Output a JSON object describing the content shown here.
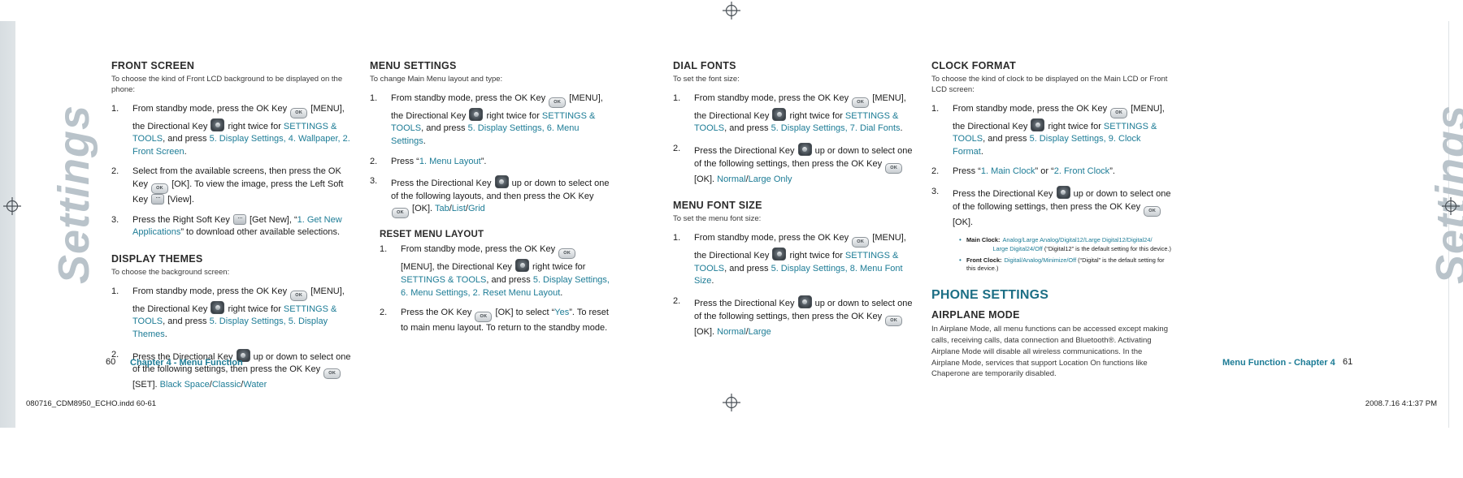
{
  "meta": {
    "watermark": "Settings",
    "file_stamp": "080716_CDM8950_ECHO.indd   60-61",
    "time_stamp": "2008.7.16   4:1:37 PM",
    "left_page_number": "60",
    "right_page_number": "61",
    "left_chapter": "Chapter 4 - Menu Function",
    "right_chapter": "Menu Function - Chapter 4",
    "accent_color": "#1d7c96",
    "heading_color": "#2b2b2b"
  },
  "keys": {
    "ok": "OK",
    "ok_name": "ok-key-icon",
    "dir_name": "directional-key-icon",
    "soft_name": "soft-key-icon"
  },
  "columns": [
    {
      "id": "front-screen",
      "sections": [
        {
          "type": "section",
          "title": "FRONT SCREEN",
          "intro": "To choose the kind of Front LCD background to be displayed on the phone:",
          "steps": [
            {
              "num": "1.",
              "parts": [
                {
                  "t": "From standby mode, press the OK Key ",
                  "k": ""
                },
                {
                  "key": "ok"
                },
                {
                  "t": " [MENU], the Directional Key "
                },
                {
                  "key": "dir"
                },
                {
                  "t": " right twice for "
                },
                {
                  "blue": "SETTINGS & TOOLS"
                },
                {
                  "t": ", and press "
                },
                {
                  "blue": "5. Display Settings, 4. Wallpaper, 2. Front Screen"
                },
                {
                  "t": "."
                }
              ]
            },
            {
              "num": "2.",
              "parts": [
                {
                  "t": "Select from the available screens, then press the OK Key "
                },
                {
                  "key": "ok"
                },
                {
                  "t": " [OK]. To view the image, press the Left Soft Key "
                },
                {
                  "key": "soft"
                },
                {
                  "t": " [View]."
                }
              ]
            },
            {
              "num": "3.",
              "parts": [
                {
                  "t": "Press the Right Soft Key "
                },
                {
                  "key": "soft"
                },
                {
                  "t": " [Get New], “"
                },
                {
                  "blue": "1. Get New Applications"
                },
                {
                  "t": "” to download other available selections."
                }
              ]
            }
          ]
        },
        {
          "type": "section",
          "title": "DISPLAY THEMES",
          "intro": "To choose the background screen:",
          "steps": [
            {
              "num": "1.",
              "parts": [
                {
                  "t": "From standby mode, press the OK Key "
                },
                {
                  "key": "ok"
                },
                {
                  "t": " [MENU], the Directional Key "
                },
                {
                  "key": "dir"
                },
                {
                  "t": " right twice for "
                },
                {
                  "blue": "SETTINGS & TOOLS"
                },
                {
                  "t": ", and press "
                },
                {
                  "blue": "5. Display Settings, 5. Display Themes"
                },
                {
                  "t": "."
                }
              ]
            },
            {
              "num": "2.",
              "parts": [
                {
                  "t": "Press the Directional Key "
                },
                {
                  "key": "dir"
                },
                {
                  "t": " up or down to select one of the following settings, then press the OK Key "
                },
                {
                  "key": "ok"
                },
                {
                  "t": " [SET]. "
                },
                {
                  "blue": "Black Space"
                },
                {
                  "t": "/"
                },
                {
                  "blue": "Classic"
                },
                {
                  "t": "/"
                },
                {
                  "blue": "Water"
                }
              ]
            }
          ]
        }
      ]
    },
    {
      "id": "menu-settings",
      "sections": [
        {
          "type": "section",
          "title": "MENU SETTINGS",
          "intro": "To change Main Menu layout and type:",
          "steps": [
            {
              "num": "1.",
              "parts": [
                {
                  "t": "From standby mode, press the OK Key "
                },
                {
                  "key": "ok"
                },
                {
                  "t": " [MENU], the Directional Key "
                },
                {
                  "key": "dir"
                },
                {
                  "t": " right twice for "
                },
                {
                  "blue": "SETTINGS & TOOLS"
                },
                {
                  "t": ", and press "
                },
                {
                  "blue": "5. Display Settings, 6. Menu Settings"
                },
                {
                  "t": "."
                }
              ]
            },
            {
              "num": "2.",
              "parts": [
                {
                  "t": "Press “"
                },
                {
                  "blue": "1. Menu Layout"
                },
                {
                  "t": "”."
                }
              ]
            },
            {
              "num": "3.",
              "parts": [
                {
                  "t": "Press the Directional Key "
                },
                {
                  "key": "dir"
                },
                {
                  "t": " up or down to select one of the following layouts, and then press the OK Key "
                },
                {
                  "key": "ok"
                },
                {
                  "t": " [OK]. "
                },
                {
                  "blue": "Tab"
                },
                {
                  "t": "/"
                },
                {
                  "blue": "List"
                },
                {
                  "t": "/"
                },
                {
                  "blue": "Grid"
                }
              ]
            }
          ]
        },
        {
          "type": "subsection",
          "title": "RESET MENU LAYOUT",
          "intro": "",
          "steps": [
            {
              "num": "1.",
              "parts": [
                {
                  "t": "From standby mode, press the OK Key "
                },
                {
                  "key": "ok"
                },
                {
                  "t": " [MENU], the Directional Key "
                },
                {
                  "key": "dir"
                },
                {
                  "t": " right twice for "
                },
                {
                  "blue": "SETTINGS & TOOLS"
                },
                {
                  "t": ", and press "
                },
                {
                  "blue": "5. Display Settings, 6. Menu Settings, 2. Reset Menu Layout"
                },
                {
                  "t": "."
                }
              ]
            },
            {
              "num": "2.",
              "parts": [
                {
                  "t": "Press the OK Key "
                },
                {
                  "key": "ok"
                },
                {
                  "t": " [OK] to select “"
                },
                {
                  "blue": "Yes"
                },
                {
                  "t": "”. To reset to main menu layout. To return to the standby mode."
                }
              ]
            }
          ]
        }
      ]
    },
    {
      "id": "dial-fonts",
      "sections": [
        {
          "type": "section",
          "title": "DIAL FONTS",
          "intro": "To set the font size:",
          "steps": [
            {
              "num": "1.",
              "parts": [
                {
                  "t": "From standby mode, press the OK Key "
                },
                {
                  "key": "ok"
                },
                {
                  "t": " [MENU], the Directional Key "
                },
                {
                  "key": "dir"
                },
                {
                  "t": " right twice for "
                },
                {
                  "blue": "SETTINGS & TOOLS"
                },
                {
                  "t": ", and press "
                },
                {
                  "blue": "5. Display Settings, 7. Dial Fonts"
                },
                {
                  "t": "."
                }
              ]
            },
            {
              "num": "2.",
              "parts": [
                {
                  "t": "Press the Directional Key "
                },
                {
                  "key": "dir"
                },
                {
                  "t": " up or down to select one of the following settings, then press the OK Key "
                },
                {
                  "key": "ok"
                },
                {
                  "t": " [OK]. "
                },
                {
                  "blue": "Normal"
                },
                {
                  "t": "/"
                },
                {
                  "blue": "Large Only"
                }
              ]
            }
          ]
        },
        {
          "type": "section",
          "title": "MENU FONT SIZE",
          "intro": "To set the menu font size:",
          "steps": [
            {
              "num": "1.",
              "parts": [
                {
                  "t": "From standby mode, press the OK Key "
                },
                {
                  "key": "ok"
                },
                {
                  "t": " [MENU], the Directional Key "
                },
                {
                  "key": "dir"
                },
                {
                  "t": " right twice for "
                },
                {
                  "blue": "SETTINGS & TOOLS"
                },
                {
                  "t": ", and press "
                },
                {
                  "blue": "5. Display Settings, 8. Menu Font Size"
                },
                {
                  "t": "."
                }
              ]
            },
            {
              "num": "2.",
              "parts": [
                {
                  "t": "Press the Directional Key "
                },
                {
                  "key": "dir"
                },
                {
                  "t": " up or down to select one of the following settings, then press the OK Key "
                },
                {
                  "key": "ok"
                },
                {
                  "t": " [OK]. "
                },
                {
                  "blue": "Normal"
                },
                {
                  "t": "/"
                },
                {
                  "blue": "Large"
                }
              ]
            }
          ]
        }
      ]
    },
    {
      "id": "clock-format",
      "sections": [
        {
          "type": "section",
          "title": "CLOCK FORMAT",
          "intro": "To choose the kind of clock to be displayed on the Main LCD or Front LCD screen:",
          "steps": [
            {
              "num": "1.",
              "parts": [
                {
                  "t": "From standby mode, press the OK Key "
                },
                {
                  "key": "ok"
                },
                {
                  "t": " [MENU], the Directional Key "
                },
                {
                  "key": "dir"
                },
                {
                  "t": " right twice for "
                },
                {
                  "blue": "SETTINGS & TOOLS"
                },
                {
                  "t": ", and press "
                },
                {
                  "blue": "5. Display Settings, 9. Clock Format"
                },
                {
                  "t": "."
                }
              ]
            },
            {
              "num": "2.",
              "parts": [
                {
                  "t": "Press “"
                },
                {
                  "blue": "1. Main Clock"
                },
                {
                  "t": "” or “"
                },
                {
                  "blue": "2. Front Clock"
                },
                {
                  "t": "”."
                }
              ]
            },
            {
              "num": "3.",
              "parts": [
                {
                  "t": "Press the Directional Key "
                },
                {
                  "key": "dir"
                },
                {
                  "t": " up or down to select one of the following settings, then press the OK Key "
                },
                {
                  "key": "ok"
                },
                {
                  "t": " [OK]."
                }
              ]
            }
          ],
          "clock_options": [
            {
              "label": "Main Clock:",
              "value": "Analog/Large Analog/Digital12/Large Digital12/Digital24/",
              "value2": "Large Digital24/Off",
              "note": " (“Digital12” is the default setting for this device.)"
            },
            {
              "label": "Front Clock:",
              "value": "Digital/Analog/Minimize/Off",
              "value2": "",
              "note": " (“Digital” is the default setting for this device.)"
            }
          ]
        },
        {
          "type": "major",
          "title": "PHONE SETTINGS"
        },
        {
          "type": "plain",
          "title": "AIRPLANE MODE",
          "body": "In Airplane Mode, all menu functions can be accessed except making calls, receiving calls, data connection and Bluetooth®. Activating Airplane Mode will disable all wireless communications. In the Airplane Mode, services that support Location On functions like Chaperone are temporarily disabled."
        }
      ]
    }
  ]
}
